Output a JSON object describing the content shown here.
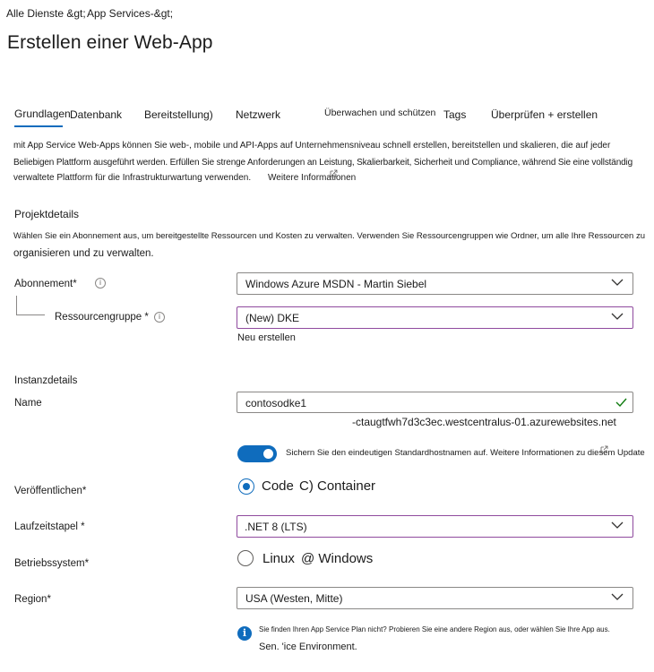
{
  "breadcrumb": {
    "item1": "Alle Dienste &gt;",
    "item2": "App Services-&gt;"
  },
  "page_title": "Erstellen einer Web-App",
  "tabs": {
    "t0": "Grundlagen",
    "t1": "Datenbank",
    "t2": "Bereitstellung)",
    "t3": "Netzwerk",
    "t4": "Überwachen und schützen",
    "t5": "Tags",
    "t6": "Überprüfen + erstellen"
  },
  "intro": {
    "line1": "mit App Service Web-Apps können Sie web-, mobile und API-Apps auf Unternehmensniveau schnell erstellen, bereitstellen und skalieren, die auf jeder",
    "line2": "Beliebigen Plattform ausgeführt werden. Erfüllen Sie strenge Anforderungen an Leistung, Skalierbarkeit, Sicherheit und Compliance, während Sie eine vollständig",
    "line3": "verwaltete Plattform für die Infrastrukturwartung verwenden.",
    "link": "Weitere Informationen"
  },
  "project": {
    "title": "Projektdetails",
    "desc1": "Wählen Sie ein Abonnement aus, um bereitgestellte Ressourcen und Kosten zu verwalten. Verwenden Sie Ressourcengruppen wie Ordner, um alle Ihre Ressourcen zu",
    "desc2": "organisieren und zu verwalten.",
    "subscription_label": "Abonnement*",
    "subscription_value": "Windows Azure MSDN - Martin Siebel",
    "rg_label": "Ressourcengruppe *",
    "rg_value": "(New) DKE",
    "rg_new_link": "Neu erstellen"
  },
  "instance": {
    "title": "Instanzdetails",
    "name_label": "Name",
    "name_value": "contosodke1",
    "hostname_suffix": "-ctaugtfwh7d3c3ec.westcentralus-01.azurewebsites.net",
    "toggle_text": "Sichern Sie den eindeutigen Standardhostnamen auf. Weitere Informationen zu diesem Update",
    "publish_label": "Veröffentlichen*",
    "publish_option1": "Code",
    "publish_option2": "C) Container",
    "runtime_label": "Laufzeitstapel *",
    "runtime_value": ".NET 8 (LTS)",
    "os_label": "Betriebssystem*",
    "os_option1": "Linux",
    "os_option2": "@ Windows",
    "region_label": "Region*",
    "region_value": "USA (Westen, Mitte)",
    "region_info1": "Sie finden Ihren App Service Plan nicht? Probieren Sie eine andere Region aus, oder wählen Sie Ihre App aus.",
    "region_info2": "Sen. 'ice Environment."
  },
  "colors": {
    "accent": "#0f6cbd",
    "focus_border": "#8f4a9e",
    "check_green": "#107c10"
  },
  "icons": [
    "info-icon",
    "chevron-down-icon",
    "checkmark-icon",
    "toggle-switch",
    "radio-button",
    "info-filled-icon",
    "external-link-icon"
  ]
}
